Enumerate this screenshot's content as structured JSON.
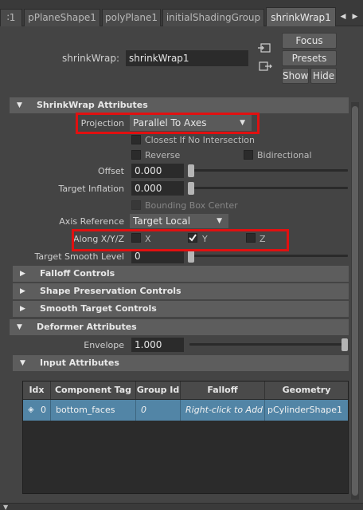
{
  "tabs": [
    {
      "label": "∶1"
    },
    {
      "label": "pPlaneShape1"
    },
    {
      "label": "polyPlane1"
    },
    {
      "label": "initialShadingGroup"
    },
    {
      "label": "shrinkWrap1",
      "active": true
    }
  ],
  "header": {
    "node_label": "shrinkWrap:",
    "node_value": "shrinkWrap1",
    "focus": "Focus",
    "presets": "Presets",
    "show": "Show",
    "hide": "Hide"
  },
  "shrinkwrap": {
    "title": "ShrinkWrap Attributes",
    "projection_label": "Projection",
    "projection_value": "Parallel To Axes",
    "closest_label": "Closest If No Intersection",
    "reverse_label": "Reverse",
    "bidirectional_label": "Bidirectional",
    "offset_label": "Offset",
    "offset_value": "0.000",
    "target_inflation_label": "Target Inflation",
    "target_inflation_value": "0.000",
    "bounding_box_label": "Bounding Box Center",
    "axis_reference_label": "Axis Reference",
    "axis_reference_value": "Target Local",
    "along_label": "Along X/Y/Z",
    "x_label": "X",
    "y_label": "Y",
    "z_label": "Z",
    "x_checked": false,
    "y_checked": true,
    "z_checked": false,
    "target_smooth_label": "Target Smooth Level",
    "target_smooth_value": "0"
  },
  "sections": {
    "falloff": "Falloff Controls",
    "shape_preservation": "Shape Preservation Controls",
    "smooth_target": "Smooth Target Controls",
    "deformer": "Deformer Attributes",
    "input": "Input Attributes"
  },
  "deformer": {
    "envelope_label": "Envelope",
    "envelope_value": "1.000"
  },
  "table": {
    "headers": [
      "Idx",
      "Component Tag",
      "Group Id",
      "Falloff",
      "Geometry"
    ],
    "rows": [
      {
        "idx": "0",
        "tag": "bottom_faces",
        "group_id": "0",
        "falloff": "Right-click to Add",
        "geometry": "pCylinderShape1"
      }
    ]
  },
  "colors": {
    "highlight_red": "#e11010",
    "row_blue": "#5285a6",
    "panel_bg": "#444444"
  }
}
